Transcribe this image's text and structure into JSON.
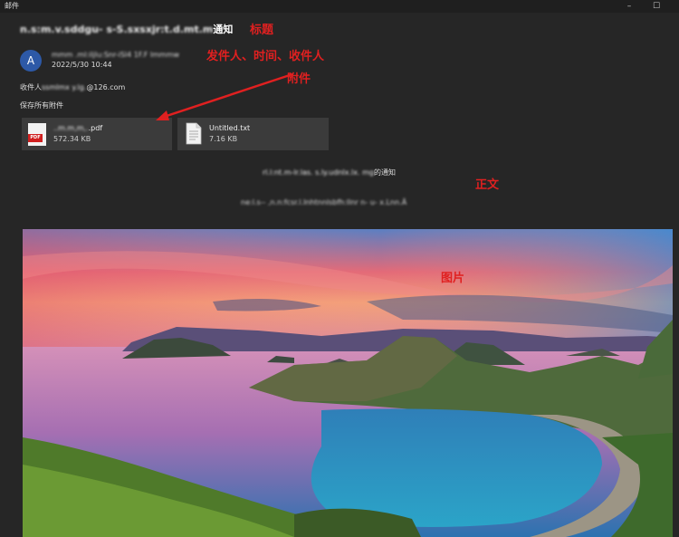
{
  "window": {
    "app_title": "邮件",
    "minimize_glyph": "–",
    "maximize_glyph": "☐"
  },
  "email": {
    "subject_blurred": "n.s:m.v.sddgu- s-S.sxsxjr:t.d.mt.m",
    "subject_suffix": "通知",
    "avatar_letter": "A",
    "sender_blurred": "mmm .ml:iljlu:Snr-iSl4 1F.F lmmmw",
    "date": "2022/5/30 10:44",
    "recipient_label": "收件人",
    "recipient_blurred": "ssmlmx y.lg.",
    "recipient_domain": "@126.com",
    "save_all": "保存所有附件",
    "body_line1_blurred": "rl.l:nt.m-lr.las. s.ly.udnIx.lx. mg",
    "body_line1_suffix": "的通知",
    "body_line2_blurred": "ne:l.s-- ,n.n:fcsr.l.Inhtnnlsbfh:llnr n- u- x.Lnn.Ä"
  },
  "attachments": [
    {
      "icon": "pdf-file-icon",
      "icon_label": "PDF",
      "name_blurred": "..m.m,m,.",
      "name_suffix": ".pdf",
      "size": "572.34 KB"
    },
    {
      "icon": "text-file-icon",
      "name": "Untitled.txt",
      "size": "7.16 KB"
    }
  ],
  "annotations": {
    "title": "标题",
    "sender_time_recipient": "发件人、时间、收件人",
    "attachments": "附件",
    "body": "正文",
    "image": "图片",
    "color": "#e02020"
  },
  "photo": {
    "description_icon": "landscape-photo"
  }
}
